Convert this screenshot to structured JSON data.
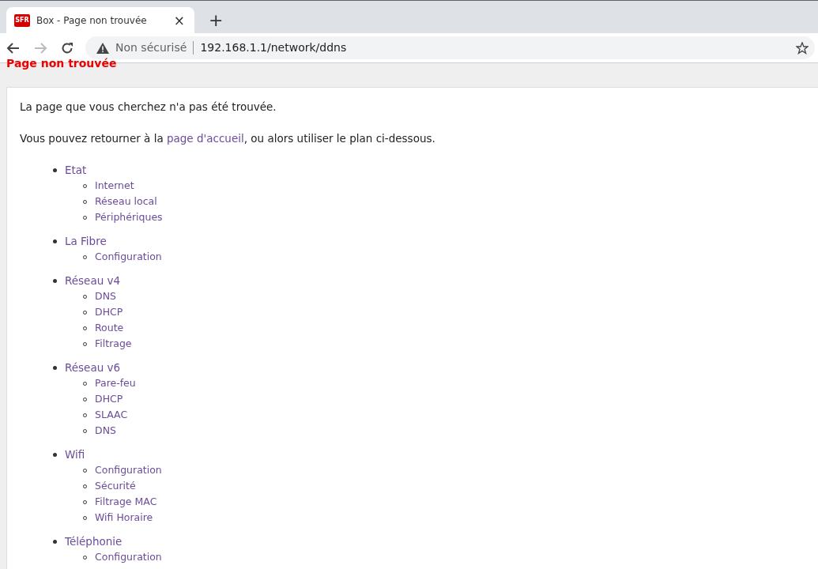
{
  "browser": {
    "tab": {
      "title": "Box - Page non trouvée",
      "favicon": "SFR",
      "close": "×"
    },
    "new_tab": "+",
    "security": "Non sécurisé",
    "url": "192.168.1.1/network/ddns"
  },
  "page": {
    "heading": "Page non trouvée",
    "message": "La page que vous cherchez n'a pas été trouvée.",
    "return_before": "Vous pouvez retourner à la ",
    "return_link": "page d'accueil",
    "return_after": ", ou alors utiliser le plan ci-dessous.",
    "sitemap": [
      {
        "label": "Etat",
        "children": [
          {
            "label": "Internet"
          },
          {
            "label": "Réseau local"
          },
          {
            "label": "Périphériques"
          }
        ]
      },
      {
        "label": "La Fibre",
        "children": [
          {
            "label": "Configuration"
          }
        ]
      },
      {
        "label": "Réseau v4",
        "children": [
          {
            "label": "DNS"
          },
          {
            "label": "DHCP"
          },
          {
            "label": "Route"
          },
          {
            "label": "Filtrage"
          }
        ]
      },
      {
        "label": "Réseau v6",
        "children": [
          {
            "label": "Pare-feu"
          },
          {
            "label": "DHCP"
          },
          {
            "label": "SLAAC"
          },
          {
            "label": "DNS"
          }
        ]
      },
      {
        "label": "Wifi",
        "children": [
          {
            "label": "Configuration"
          },
          {
            "label": "Sécurité"
          },
          {
            "label": "Filtrage MAC"
          },
          {
            "label": "Wifi Horaire"
          }
        ]
      },
      {
        "label": "Téléphonie",
        "children": [
          {
            "label": "Configuration"
          }
        ]
      }
    ]
  }
}
